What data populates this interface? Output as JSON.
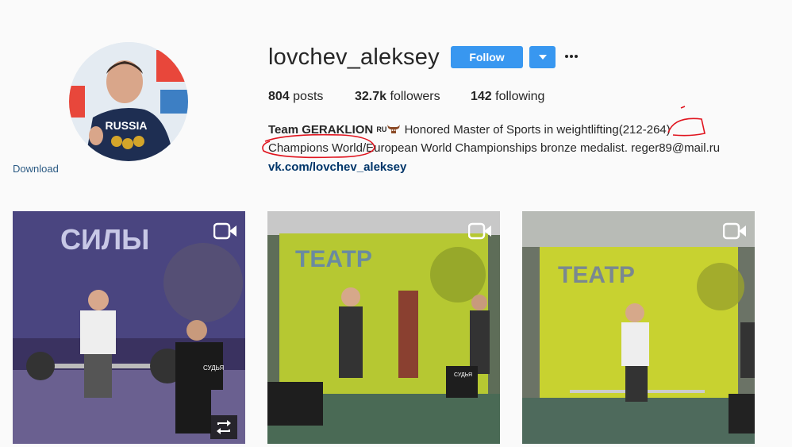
{
  "profile": {
    "username": "lovchev_aleksey",
    "download_label": "Download",
    "avatar_shirt_text": "RUSSIA"
  },
  "actions": {
    "follow_label": "Follow"
  },
  "stats": {
    "posts_count": "804",
    "posts_label": "posts",
    "followers_count": "32.7k",
    "followers_label": "followers",
    "following_count": "142",
    "following_label": "following"
  },
  "bio": {
    "name": "Team GERAKLION",
    "flag_text": "RU",
    "line1_text": " Honored Master of Sports in weightlifting(212-264)",
    "line2_text": "Champions World/European World Championships bronze medalist. reger89@mail.ru",
    "link": "vk.com/lovchev_aleksey"
  },
  "posts": [
    {
      "type": "video",
      "repost": true,
      "banner_text": "СИЛЫ",
      "shirt_text": "СУДЬЯ"
    },
    {
      "type": "video",
      "repost": false,
      "banner_text": "ТЕАТР",
      "shirt_text": "СУДЬЯ"
    },
    {
      "type": "video",
      "repost": false,
      "banner_text": "ТЕАТР",
      "shirt_text": ""
    }
  ],
  "colors": {
    "accent": "#3897f0",
    "link": "#003569",
    "annotation": "#e0141e"
  }
}
